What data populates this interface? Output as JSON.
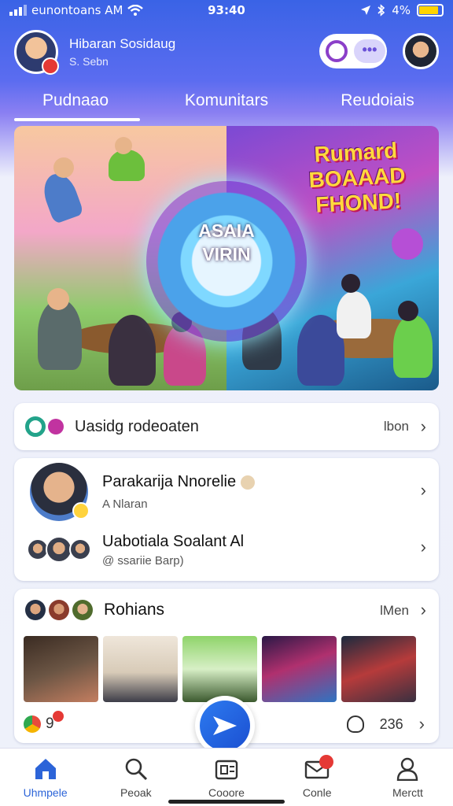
{
  "status_bar": {
    "carrier": "eunontoans AM",
    "time": "93:40",
    "battery": "4%",
    "battery_level": 0.85,
    "icons": [
      "signal-icon",
      "wifi-icon",
      "location-icon",
      "bluetooth-icon",
      "battery-icon"
    ]
  },
  "header": {
    "user_name": "Hibaran Sosidaug",
    "user_sub": "S. Sebn",
    "icons": [
      "avatar",
      "search-icon",
      "more-icon",
      "profile-avatar"
    ]
  },
  "tabs": [
    {
      "label": "Pudnaao",
      "active": true
    },
    {
      "label": "Komunitars",
      "active": false
    },
    {
      "label": "Reudoiais",
      "active": false
    }
  ],
  "hero": {
    "wheel_text": "ASAIA VIRIN",
    "banner_title": "Rumard BOAAAD FHOND!"
  },
  "recommendation": {
    "title": "Uasidg rodeoaten",
    "link": "lbon"
  },
  "friends": [
    {
      "name": "Parakarija Nnorelie",
      "sub": "A Nlaran"
    },
    {
      "name": "Uabotiala Soalant Al",
      "sub": "@ ssariie Barp)"
    }
  ],
  "moments": {
    "title": "Rohians",
    "link": "lMen",
    "count": "9",
    "right_count": "236"
  },
  "bottom_nav": [
    {
      "label": "Uhmpele",
      "icon": "home-icon",
      "active": true
    },
    {
      "label": "Peoak",
      "icon": "search-icon",
      "active": false
    },
    {
      "label": "Cooore",
      "icon": "create-icon",
      "active": false
    },
    {
      "label": "Conle",
      "icon": "mail-icon",
      "active": false
    },
    {
      "label": "Merctt",
      "icon": "profile-icon",
      "active": false
    }
  ],
  "colors": {
    "accent": "#2c64d8",
    "header_gradient_start": "#3a63e6",
    "header_gradient_end": "#8a7ff2",
    "badge": "#e53935"
  }
}
